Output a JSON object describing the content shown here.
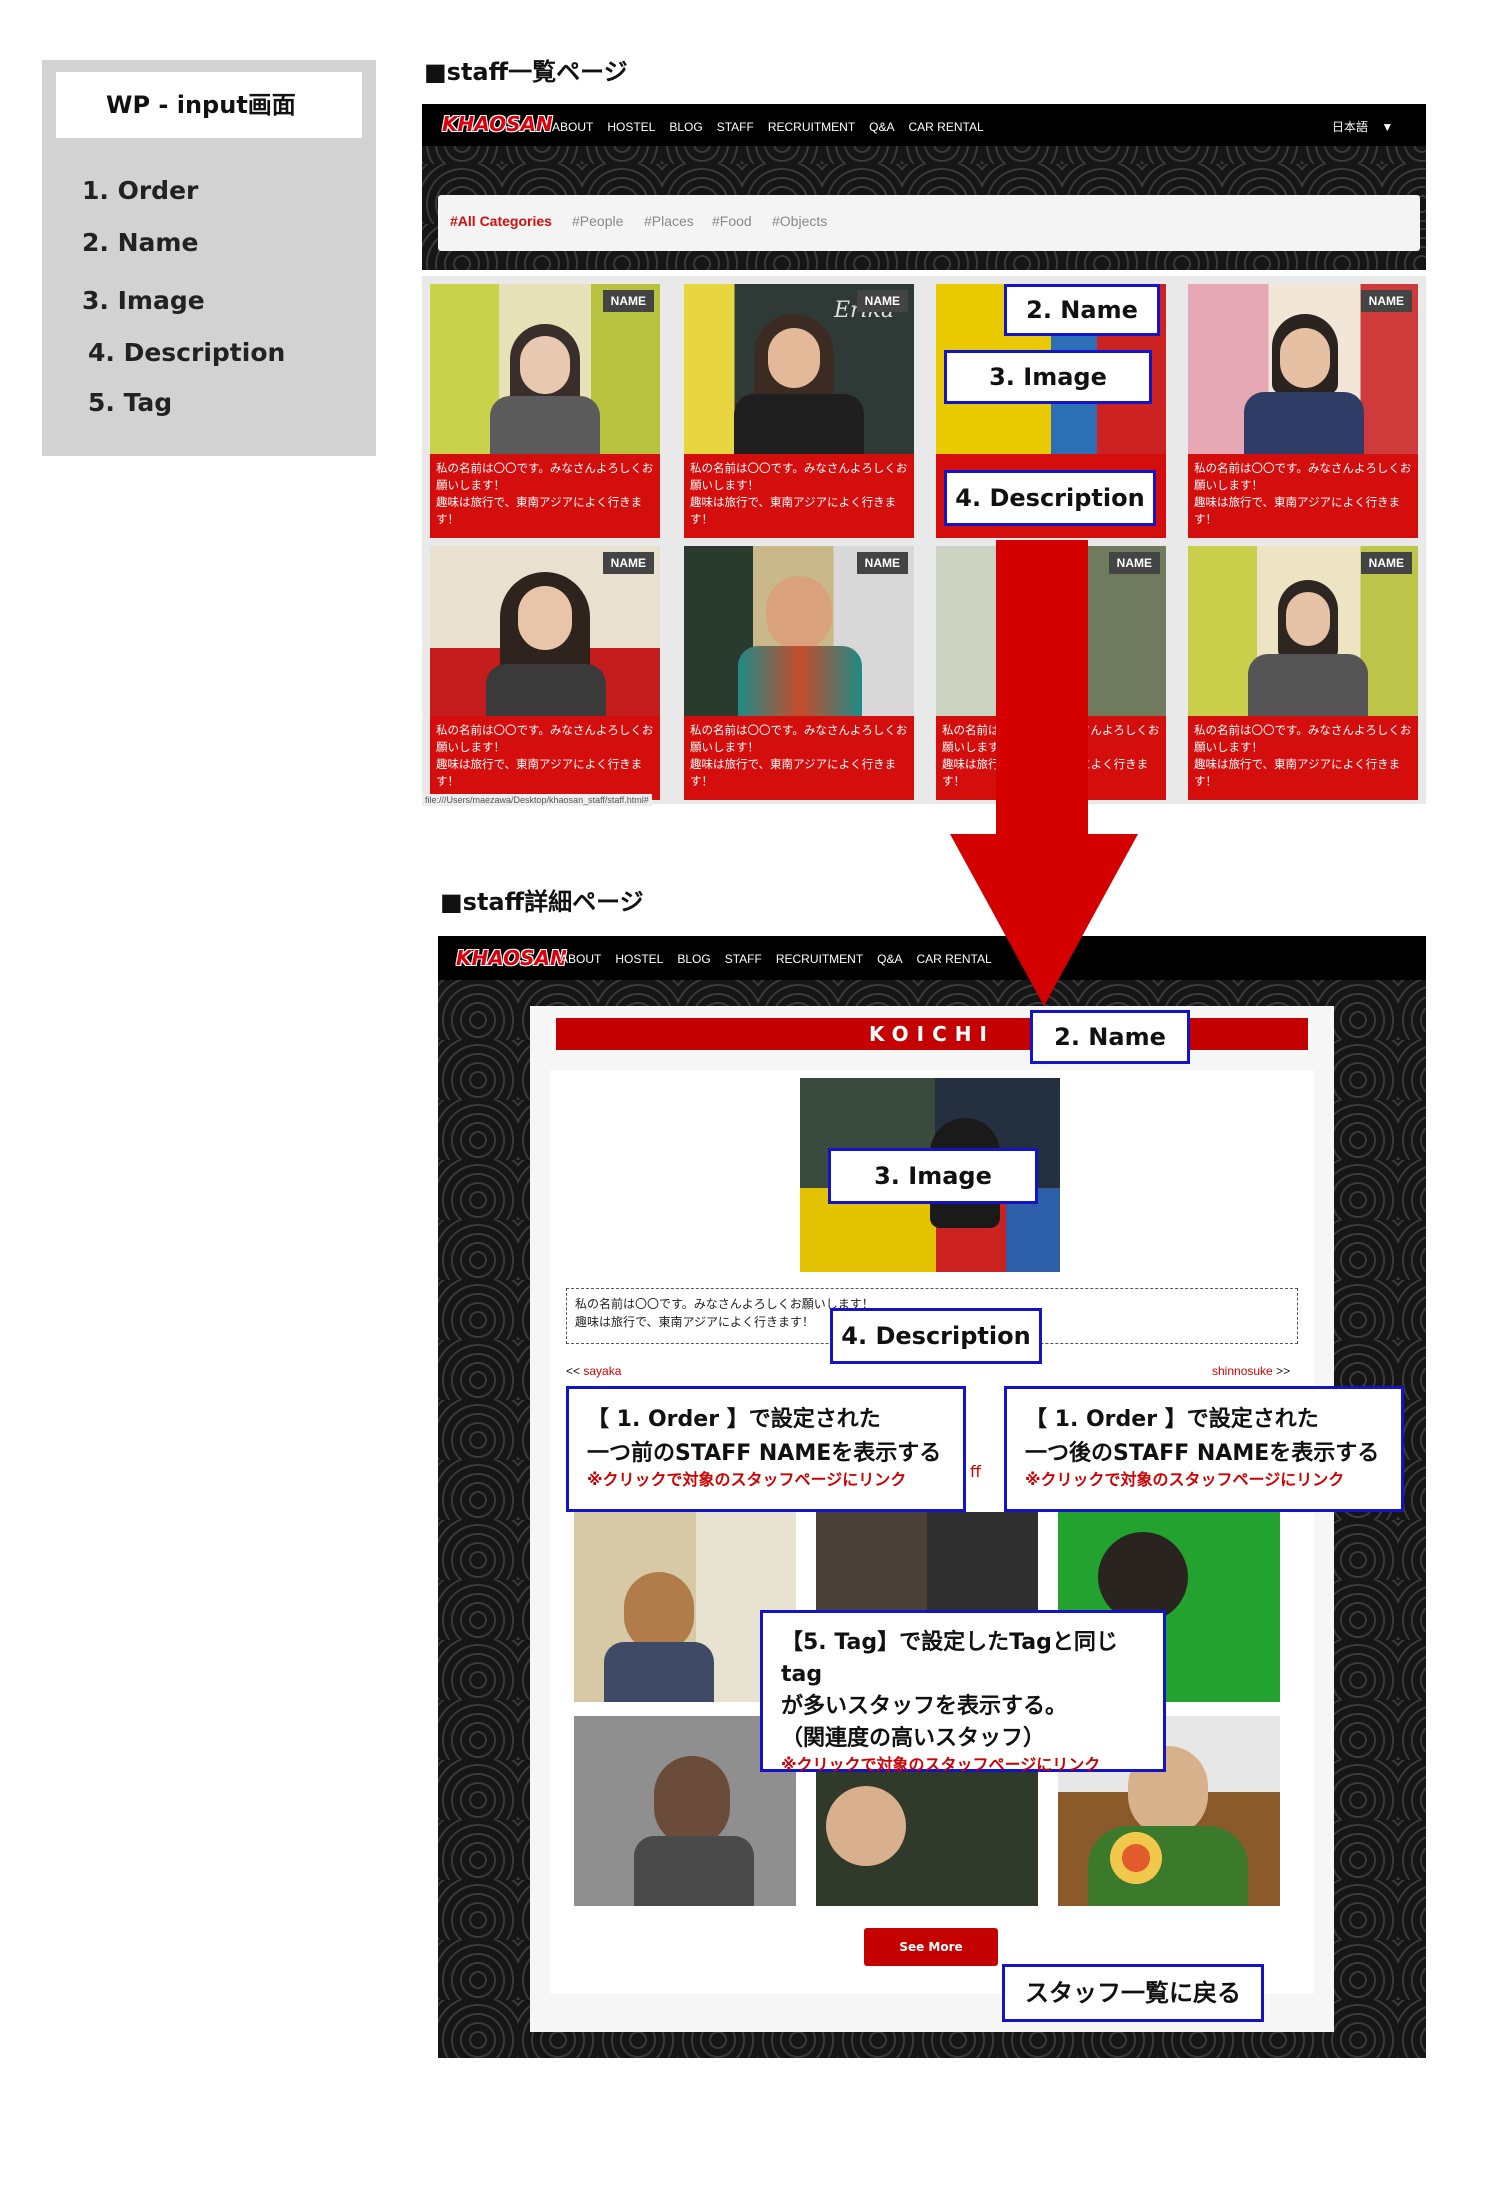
{
  "wp_panel": {
    "title": "WP - input画面",
    "items": [
      "1. Order",
      "2. Name",
      "3. Image",
      "4. Description",
      "5. Tag"
    ]
  },
  "list_page": {
    "section_title": "■staff一覧ページ",
    "logo": "KHAOSAN",
    "nav": [
      "ABOUT",
      "HOSTEL",
      "BLOG",
      "STAFF",
      "RECRUITMENT",
      "Q&A",
      "CAR RENTAL"
    ],
    "language": "日本語",
    "categories": [
      "#All Categories",
      "#People",
      "#Places",
      "#Food",
      "#Objects"
    ],
    "card_name_badge": "NAME",
    "card_desc_line1": "私の名前は〇〇です。みなさんよろしくお",
    "card_desc_line2": "願いします！",
    "card_desc_line3": "趣味は旅行で、東南アジアによく行きま",
    "card_desc_line4": "す！",
    "card_photo_sign": "Erika",
    "status_url": "file:///Users/maezawa/Desktop/khaosan_staff/staff.html#",
    "annotations": {
      "name": "2. Name",
      "image": "3. Image",
      "description": "4. Description"
    }
  },
  "detail_page": {
    "section_title": "■staff詳細ページ",
    "logo": "KHAOSAN",
    "nav": [
      "ABOUT",
      "HOSTEL",
      "BLOG",
      "STAFF",
      "RECRUITMENT",
      "Q&A",
      "CAR RENTAL"
    ],
    "staff_name": "KOICHI",
    "desc_line1": "私の名前は〇〇です。みなさんよろしくお願いします！",
    "desc_line2": "趣味は旅行で、東南アジアによく行きます！",
    "prev_arrow": "<<",
    "prev_name": "sayaka",
    "next_name": "shinnosuke",
    "next_arrow": ">>",
    "related_label_fragment": "ff",
    "see_more": "See More",
    "annotations": {
      "name": "2. Name",
      "image": "3. Image",
      "description": "4. Description",
      "prev_line1": "【 1. Order 】で設定された",
      "prev_line2": "一つ前のSTAFF NAMEを表示する",
      "prev_note": "※クリックで対象のスタッフページにリンク",
      "next_line1": "【 1. Order 】で設定された",
      "next_line2": "一つ後のSTAFF NAMEを表示する",
      "next_note": "※クリックで対象のスタッフページにリンク",
      "tag_line1": "【5. Tag】で設定したTagと同じtag",
      "tag_line2": "が多いスタッフを表示する。",
      "tag_line3": "（関連度の高いスタッフ）",
      "tag_note": "※クリックで対象のスタッフページにリンク",
      "back": "スタッフ一覧に戻る"
    }
  },
  "colors": {
    "brand_red": "#d40d0d",
    "annotation_blue": "#1313c8",
    "arrow_red": "#d40000"
  }
}
